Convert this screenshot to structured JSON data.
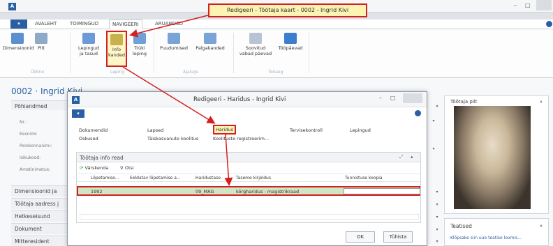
{
  "window": {
    "title": "Redigeeri - Töötaja kaart - 0002 - Ingrid Kivi",
    "logo": "A"
  },
  "ribbon": {
    "tabs": [
      "AVALEHT",
      "TOIMINGUD",
      "NAVIGEERI",
      "ARUANDED"
    ],
    "buttons": {
      "dimensions": "Dimensioonid",
      "picture": "Pilt",
      "contracts_1": "Lepingud",
      "contracts_2": "ja tasud",
      "info_1": "Info",
      "info_2": "kanded",
      "print_1": "Trüki",
      "print_2": "leping",
      "absences": "Puudumised",
      "salary": "Palgakanded",
      "pref_vac_1": "Soovitud",
      "pref_vac_2": "vabad päevad",
      "workdays": "Tööpäevad"
    },
    "groups": [
      "Üldine",
      "Leping",
      "Ajalugu",
      "Tööaeg"
    ]
  },
  "page": {
    "title": "0002 · Ingrid Kivi",
    "fasttabs_top": "Põhiandmed",
    "fields": [
      "Nr.:",
      "Eesnimi:",
      "Perekonnanimi:",
      "Isikukood:",
      "Ametinimetus:"
    ],
    "fasttabs_bottom": [
      "Dimensioonid ja",
      "Töötaja aadress j",
      "Hetkeseisund",
      "Dokument",
      "Mitteresident"
    ]
  },
  "dialog": {
    "title": "Redigeeri - Haridus - Ingrid Kivi",
    "logo": "A",
    "actions_row1": [
      "Dokumendid",
      "Lapsed",
      "Haridus",
      "Tervisekontroll",
      "Lepingud"
    ],
    "actions_row2": [
      "Oskused",
      "Täiskasvanute koolitus",
      "Koolituste registreerim..."
    ],
    "subpage_title": "Töötaja info read",
    "refresh": "Värskenda",
    "find": "Otsi",
    "columns": [
      "Lõpetamise...",
      "Eeldatav lõpetamise a...",
      "Haridustase",
      "Taseme kirjeldus",
      "Tunnistuse koopia"
    ],
    "rows": [
      [
        "1992",
        "",
        "09_MAG",
        "kõrgharidus - magistrikraad",
        ""
      ]
    ],
    "ok": "OK",
    "cancel": "Tühista"
  },
  "right_panel": {
    "photo_title": "Töötaja pilt",
    "notes_title": "Teatised",
    "notes_link": "Klõpsake siin uue teatise loomis..."
  },
  "colors": {
    "accent": "#2a5fa5",
    "highlight_border": "#d42020",
    "callout_bg": "#fdf3b2",
    "selected_row": "#cfe6c4"
  }
}
